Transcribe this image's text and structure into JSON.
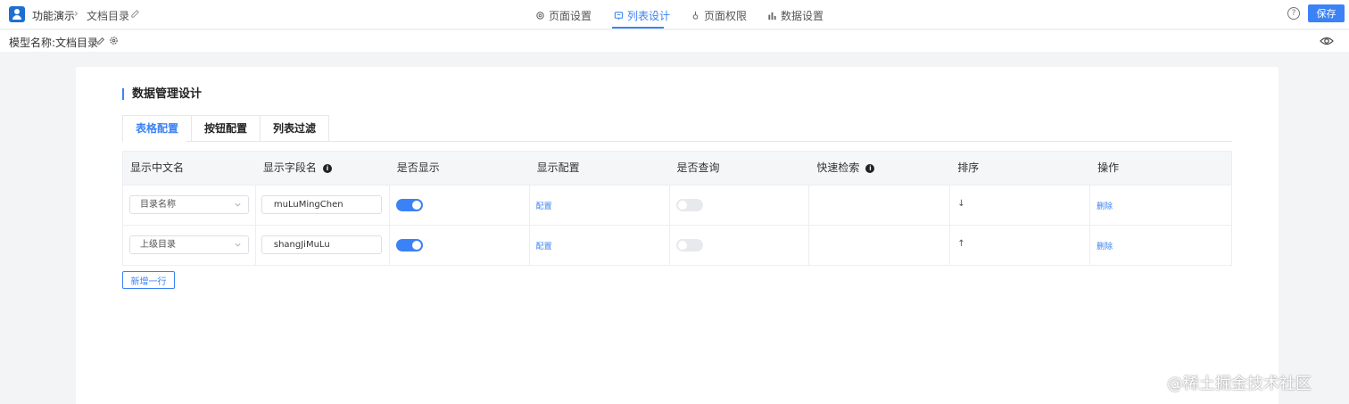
{
  "header": {
    "app_name": "功能演示",
    "breadcrumb_sep": "›",
    "page_name": "文档目录",
    "tabs": [
      {
        "label": "页面设置",
        "icon": "gear-icon"
      },
      {
        "label": "列表设计",
        "icon": "list-design-icon"
      },
      {
        "label": "页面权限",
        "icon": "permission-icon"
      },
      {
        "label": "数据设置",
        "icon": "bar-chart-icon"
      }
    ],
    "active_tab": "列表设计",
    "help_icon": "?",
    "save_label": "保存",
    "accent_color": "#3b82f6"
  },
  "subheader": {
    "model_label": "模型名称:",
    "model_value": "文档目录"
  },
  "section": {
    "title": "数据管理设计",
    "subtabs": [
      "表格配置",
      "按钮配置",
      "列表过滤"
    ],
    "active_subtab": "表格配置"
  },
  "table": {
    "columns": [
      "显示中文名",
      "显示字段名",
      "是否显示",
      "显示配置",
      "是否查询",
      "快速检索",
      "排序",
      "操作"
    ],
    "rows": [
      {
        "display_name": "目录名称",
        "field_name": "muLuMingChen",
        "visible": true,
        "config": "配置",
        "queryable": false,
        "sort": "↓",
        "action": "删除"
      },
      {
        "display_name": "上级目录",
        "field_name": "shangJiMuLu",
        "visible": true,
        "config": "配置",
        "queryable": false,
        "sort": "↑",
        "action": "删除"
      }
    ]
  },
  "add_row_label": "新增一行",
  "site_watermark": "@稀土掘金技术社区"
}
